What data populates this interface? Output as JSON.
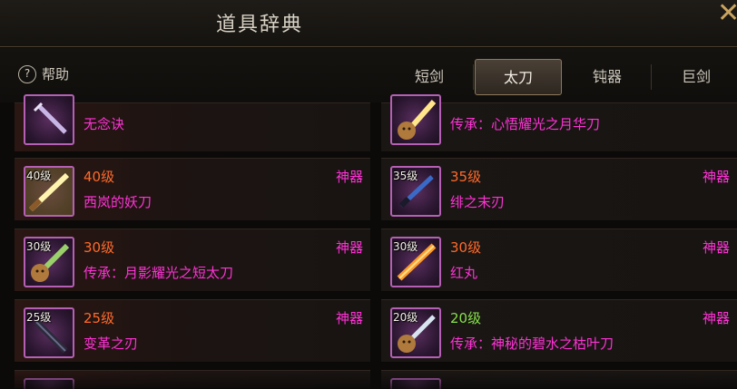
{
  "title": "道具辞典",
  "help_label": "帮助",
  "help_glyph": "?",
  "close_glyph": "✕",
  "tabs": [
    {
      "label": "短剑",
      "active": false
    },
    {
      "label": "太刀",
      "active": true
    },
    {
      "label": "钝器",
      "active": false
    },
    {
      "label": "巨剑",
      "active": false
    }
  ],
  "items": [
    {
      "level_tag": "",
      "level": "",
      "tier": "",
      "name": "无念诀",
      "icon": "purple-blade-icon",
      "level_color": "orange"
    },
    {
      "level_tag": "",
      "level": "",
      "tier": "",
      "name": "传承：心悟耀光之月华刀",
      "icon": "golden-blade-mascot-icon",
      "level_color": "orange"
    },
    {
      "level_tag": "40级",
      "level": "40级",
      "tier": "神器",
      "name": "西岚的妖刀",
      "icon": "glowing-gold-blade-icon",
      "level_color": "orange"
    },
    {
      "level_tag": "35级",
      "level": "35级",
      "tier": "神器",
      "name": "绯之末刃",
      "icon": "blue-katana-icon",
      "level_color": "orange"
    },
    {
      "level_tag": "30级",
      "level": "30级",
      "tier": "神器",
      "name": "传承：月影耀光之短太刀",
      "icon": "green-blade-mascot-icon",
      "level_color": "orange"
    },
    {
      "level_tag": "30级",
      "level": "30级",
      "tier": "神器",
      "name": "红丸",
      "icon": "flame-blade-icon",
      "level_color": "orange"
    },
    {
      "level_tag": "25级",
      "level": "25级",
      "tier": "神器",
      "name": "变革之刃",
      "icon": "dark-blade-icon",
      "level_color": "orange"
    },
    {
      "level_tag": "20级",
      "level": "20级",
      "tier": "神器",
      "name": "传承：神秘的碧水之枯叶刀",
      "icon": "silver-blade-mascot-icon",
      "level_color": "green"
    }
  ],
  "colors": {
    "accent_gold": "#c9a460",
    "tier_magenta": "#ff33d6",
    "level_orange": "#ff6a2a",
    "level_green": "#86e04a",
    "icon_border": "#b560b5"
  }
}
